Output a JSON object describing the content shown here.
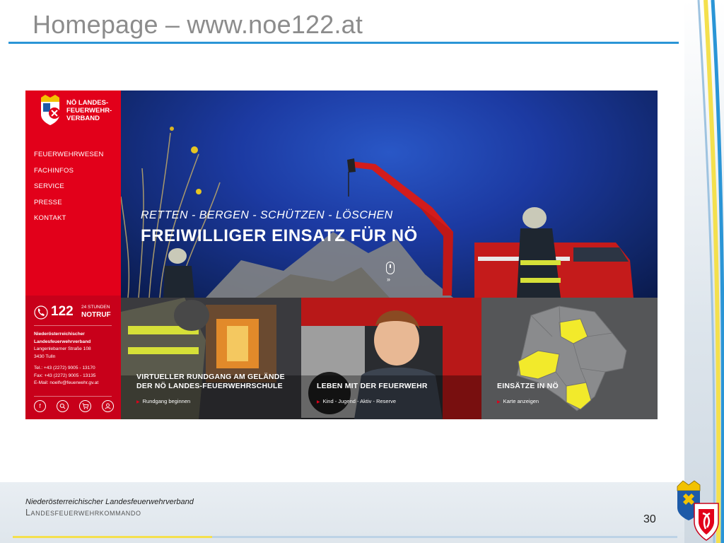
{
  "slide": {
    "title": "Homepage – www.noe122.at",
    "page_number": "30"
  },
  "footer": {
    "line1": "Niederösterreichischer Landesfeuerwehrverband",
    "line2": "Landesfeuerwehrkommando"
  },
  "site": {
    "logo_lines": [
      "NÖ LANDES-",
      "FEUERWEHR-",
      "VERBAND"
    ],
    "nav": [
      "FEUERWEHRWESEN",
      "FACHINFOS",
      "SERVICE",
      "PRESSE",
      "KONTAKT"
    ],
    "emergency": {
      "number": "122",
      "hours": "24 STUNDEN",
      "label": "NOTRUF"
    },
    "address": {
      "name1": "Niederösterreichischer",
      "name2": "Landesfeuerwehrverband",
      "street": "Langenlebarner Straße 108",
      "city": "3430 Tulln",
      "tel": "Tel.: +43 (2272) 9005 - 13170",
      "fax": "Fax: +43 (2272) 9005 - 13135",
      "email": "E-Mail: noelfv@feuerwehr.gv.at"
    },
    "social_icons": [
      "facebook-icon",
      "search-icon",
      "shop-cart-icon",
      "user-icon"
    ],
    "hero": {
      "subtitle": "RETTEN - BERGEN - SCHÜTZEN - LÖSCHEN",
      "title": "FREIWILLIGER EINSATZ FÜR NÖ"
    },
    "tiles": [
      {
        "title1": "VIRTUELLER RUNDGANG AM GELÄNDE",
        "title2": "DER NÖ LANDES-FEUERWEHRSCHULE",
        "link": "Rundgang beginnen"
      },
      {
        "title1": "LEBEN MIT DER FEUERWEHR",
        "title2": "",
        "link": "Kind - Jugend - Aktiv - Reserve"
      },
      {
        "title1": "EINSÄTZE IN NÖ",
        "title2": "",
        "link": "Karte anzeigen"
      }
    ]
  },
  "colors": {
    "brand_red": "#e2001a",
    "title_rule": "#2a95d6",
    "highlight_yellow": "#f2ea2b"
  }
}
